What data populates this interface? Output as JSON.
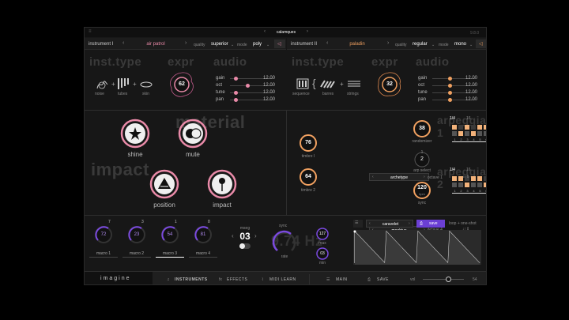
{
  "app": {
    "name": "imagine",
    "title": "calamques",
    "version": "9.8.0"
  },
  "instrument1": {
    "label": "instrument I",
    "preset": "air patrol",
    "quality_label": "quality",
    "quality": "superior",
    "mode_label": "mode",
    "mode": "poly",
    "sections": {
      "type": "inst.type",
      "expr": "expr",
      "audio": "audio"
    },
    "types": [
      "noise",
      "tubes",
      "skin"
    ],
    "expr_value": "62",
    "audio": [
      {
        "label": "gain",
        "value": "12.00",
        "level": 0.1
      },
      {
        "label": "oct",
        "value": "12.00",
        "level": 0.4
      },
      {
        "label": "tune",
        "value": "12.00",
        "level": 0.1
      },
      {
        "label": "pan",
        "value": "12.00",
        "level": 0.1
      }
    ]
  },
  "instrument2": {
    "label": "instrument II",
    "preset": "paladin",
    "quality_label": "quality",
    "quality": "regular",
    "mode_label": "mode",
    "mode": "mono",
    "sections": {
      "type": "inst.type",
      "expr": "expr",
      "audio": "audio"
    },
    "types": [
      "sequence",
      "barres",
      "strings"
    ],
    "expr_value": "32",
    "audio": [
      {
        "label": "gain",
        "value": "12.00",
        "level": 0.4
      },
      {
        "label": "oct",
        "value": "12.00",
        "level": 0.4
      },
      {
        "label": "tune",
        "value": "12.00",
        "level": 0.4
      },
      {
        "label": "pan",
        "value": "12.00",
        "level": 0.4
      }
    ]
  },
  "material": {
    "ghost_top": "material",
    "ghost_left": "impact",
    "knobs": [
      {
        "label": "shine",
        "icon": "star-icon"
      },
      {
        "label": "mute",
        "icon": "mute-circles-icon"
      },
      {
        "label": "position",
        "icon": "position-icon"
      },
      {
        "label": "impact",
        "icon": "pin-icon"
      }
    ]
  },
  "arp": {
    "timbre1": {
      "value": "76",
      "label": "timbre I"
    },
    "timbre2": {
      "value": "64",
      "label": "timbre 2"
    },
    "randomizer": {
      "value": "38",
      "label": "randomizer"
    },
    "arp_select": {
      "value": "2",
      "top": "1",
      "label": "arp select"
    },
    "sync": {
      "value": "120",
      "unit": "bpm",
      "label": "sync"
    },
    "arp1": {
      "title": "arpeggiator 1",
      "rate": "1/4",
      "steps_label": "16",
      "pattern": "archetype",
      "octave": "octave 1",
      "numbers": [
        "1",
        "2",
        "3",
        "4",
        "5",
        "6",
        "7",
        "8",
        "9",
        "10",
        "11",
        "12",
        "13",
        "14",
        "15",
        "16"
      ],
      "active": [
        1,
        0,
        1,
        0,
        1,
        1,
        0,
        1,
        0,
        1,
        1,
        0,
        1,
        0,
        1,
        0
      ]
    },
    "arp2": {
      "title": "arpeggiator 2",
      "rate": "1/4",
      "steps_label": "16",
      "pattern": "moebius",
      "octave": "octave 4",
      "numbers": [
        "1",
        "2",
        "3",
        "4",
        "5",
        "6",
        "7",
        "8"
      ],
      "active": [
        1,
        1,
        0,
        1,
        1,
        0,
        1,
        0,
        1,
        1,
        0,
        1,
        0,
        1,
        1,
        0
      ]
    }
  },
  "bottom": {
    "macros": [
      {
        "value": "72",
        "top": "7",
        "label": "macro 1"
      },
      {
        "value": "23",
        "top": "3",
        "label": "macro 2"
      },
      {
        "value": "54",
        "top": "1",
        "label": "macro 3"
      },
      {
        "value": "81",
        "top": "8",
        "label": "macro 4"
      }
    ],
    "mseg": {
      "label": "mseg",
      "value": "03"
    },
    "rate": {
      "label": "rate",
      "sync": "sync",
      "big": "9.74 Hz"
    },
    "max": {
      "value": "127",
      "label": "max"
    },
    "min": {
      "value": "03",
      "label": "min"
    },
    "lfo": {
      "preset": "caravelet",
      "save": "save",
      "loop": "loop + one-shot"
    }
  },
  "footer": {
    "logo": "imagine",
    "instruments": "INSTRUMENTS",
    "effects": "EFFECTS",
    "midi": "MIDI LEARN",
    "main": "MAIN",
    "save": "SAVE",
    "vol": "vol",
    "vol_value": "54",
    "vol_level": 0.6
  },
  "colors": {
    "accent_pink": "#e98aa8",
    "accent_orange": "#f0a060",
    "accent_purple": "#7b4ae0",
    "step_on": "#f2b27a",
    "step_off": "#3a3a3a"
  }
}
